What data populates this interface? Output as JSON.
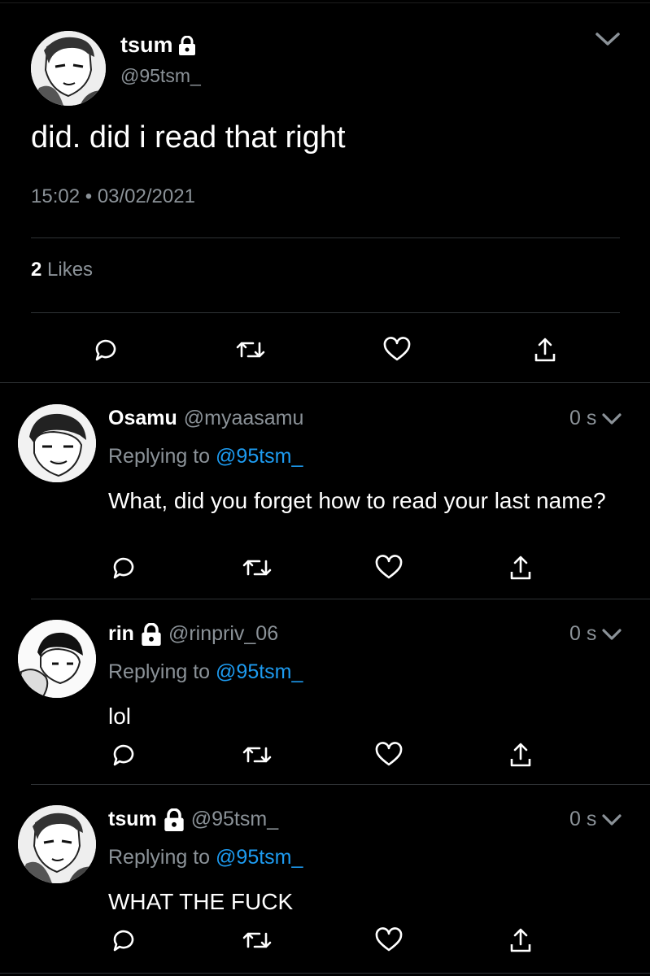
{
  "main_tweet": {
    "display_name": "tsum",
    "handle": "@95tsm_",
    "text": "did. did i read that right",
    "time": "15:02",
    "date": "03/02/2021",
    "meta_separator": "•",
    "likes_count": "2",
    "likes_label": "Likes"
  },
  "replies": [
    {
      "display_name": "Osamu",
      "handle": "@myaasamu",
      "time": "0 s",
      "replying_label": "Replying to",
      "replying_to": "@95tsm_",
      "text": "What, did you forget how to read your last name?",
      "locked": false
    },
    {
      "display_name": "rin",
      "handle": "@rinpriv_06",
      "time": "0 s",
      "replying_label": "Replying to",
      "replying_to": "@95tsm_",
      "text": "lol",
      "locked": true
    },
    {
      "display_name": "tsum",
      "handle": "@95tsm_",
      "time": "0 s",
      "replying_label": "Replying to",
      "replying_to": "@95tsm_",
      "text": "WHAT THE FUCK",
      "locked": true
    }
  ],
  "icons": {
    "reply": "reply-icon",
    "retweet": "retweet-icon",
    "like": "heart-icon",
    "share": "share-icon",
    "lock": "lock-icon",
    "chevron": "chevron-down-icon"
  },
  "colors": {
    "background": "#000000",
    "text": "#ffffff",
    "secondary": "#8b9298",
    "mention": "#1d9bf0",
    "divider": "#2f3336"
  }
}
